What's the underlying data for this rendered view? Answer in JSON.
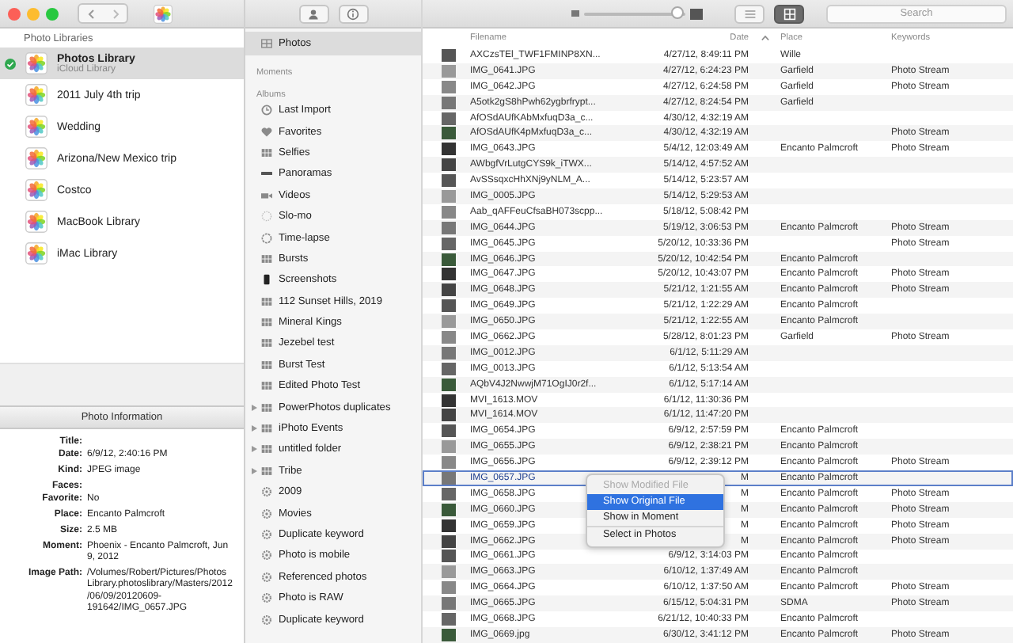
{
  "libraries": {
    "header": "Photo Libraries",
    "items": [
      {
        "name": "Photos Library",
        "subtitle": "iCloud Library",
        "selected": true,
        "current": true
      },
      {
        "name": "2011 July 4th trip",
        "selected": false,
        "current": false
      },
      {
        "name": "Wedding",
        "selected": false,
        "current": false
      },
      {
        "name": "Arizona/New Mexico trip",
        "selected": false,
        "current": false
      },
      {
        "name": "Costco",
        "selected": false,
        "current": false
      },
      {
        "name": "MacBook Library",
        "selected": false,
        "current": false
      },
      {
        "name": "iMac Library",
        "selected": false,
        "current": false
      }
    ]
  },
  "photo_information": {
    "title": "Photo Information",
    "fields": [
      {
        "label": "Title:"
      },
      {
        "label": "Date:",
        "value": "6/9/12, 2:40:16 PM"
      },
      {
        "label": "Kind:",
        "value": "JPEG image"
      },
      {
        "label": "Faces:"
      },
      {
        "label": "Favorite:",
        "value": "No"
      },
      {
        "label": "Place:",
        "value": "Encanto Palmcroft"
      },
      {
        "label": "Size:",
        "value": "2.5 MB"
      },
      {
        "label": "Moment:",
        "value": "Phoenix - Encanto Palmcroft, Jun 9, 2012"
      },
      {
        "label": "Image Path:",
        "value": "/Volumes/Robert/Pictures/Photos Library.photoslibrary/Masters/2012/06/09/20120609-191642/IMG_0657.JPG"
      }
    ]
  },
  "sidebar": {
    "items": [
      {
        "kind": "photos",
        "label": "Photos",
        "selected": true
      },
      {
        "kind": "header",
        "label": "Moments"
      },
      {
        "kind": "header",
        "label": "Albums"
      },
      {
        "kind": "import",
        "label": "Last Import",
        "selected": false
      },
      {
        "kind": "favorites",
        "label": "Favorites",
        "selected": false
      },
      {
        "kind": "album",
        "label": "Selfies",
        "selected": false
      },
      {
        "kind": "panoramas",
        "label": "Panoramas",
        "selected": false
      },
      {
        "kind": "videos",
        "label": "Videos",
        "selected": false
      },
      {
        "kind": "slomo",
        "label": "Slo-mo",
        "selected": false
      },
      {
        "kind": "timelapse",
        "label": "Time-lapse",
        "selected": false
      },
      {
        "kind": "album",
        "label": "Bursts",
        "selected": false
      },
      {
        "kind": "screenshots",
        "label": "Screenshots",
        "selected": false
      },
      {
        "kind": "album",
        "label": "112 Sunset Hills, 2019",
        "selected": false
      },
      {
        "kind": "album",
        "label": "Mineral Kings",
        "selected": false
      },
      {
        "kind": "album",
        "label": "Jezebel test",
        "selected": false
      },
      {
        "kind": "album",
        "label": "Burst Test",
        "selected": false
      },
      {
        "kind": "album",
        "label": "Edited Photo Test",
        "selected": false
      },
      {
        "kind": "folder",
        "label": "PowerPhotos duplicates",
        "selected": false
      },
      {
        "kind": "folder",
        "label": "iPhoto Events",
        "selected": false
      },
      {
        "kind": "folder",
        "label": "untitled folder",
        "selected": false
      },
      {
        "kind": "folder",
        "label": "Tribe",
        "selected": false
      },
      {
        "kind": "smart",
        "label": "2009",
        "selected": false
      },
      {
        "kind": "smart",
        "label": "Movies",
        "selected": false
      },
      {
        "kind": "smart",
        "label": "Duplicate keyword",
        "selected": false
      },
      {
        "kind": "smart",
        "label": "Photo is mobile",
        "selected": false
      },
      {
        "kind": "smart",
        "label": "Referenced photos",
        "selected": false
      },
      {
        "kind": "smart",
        "label": "Photo is RAW",
        "selected": false
      },
      {
        "kind": "smart",
        "label": "Duplicate keyword",
        "selected": false
      }
    ]
  },
  "toolbar": {
    "zoom_slider": {
      "level": 0.92
    },
    "view_buttons": [
      {
        "kind": "list",
        "selected": false
      },
      {
        "kind": "grid",
        "selected": true
      }
    ],
    "search": {
      "placeholder": "Search"
    }
  },
  "table": {
    "columns": [
      {
        "label": "Filename",
        "sorted": false
      },
      {
        "label": "Date",
        "sorted": true
      },
      {
        "label": "Place",
        "sorted": false
      },
      {
        "label": "Keywords",
        "sorted": false
      }
    ],
    "rows": [
      {
        "filename": "AXCzsTEl_TWF1FMINP8XN...",
        "date": "4/27/12, 8:49:11 PM",
        "place": "Wille",
        "selected": false
      },
      {
        "filename": "IMG_0641.JPG",
        "date": "4/27/12, 6:24:23 PM",
        "place": "Garfield",
        "keywords": "Photo Stream",
        "selected": false
      },
      {
        "filename": "IMG_0642.JPG",
        "date": "4/27/12, 6:24:58 PM",
        "place": "Garfield",
        "keywords": "Photo Stream",
        "selected": false
      },
      {
        "filename": "A5otk2gS8hPwh62ygbrfrypt...",
        "date": "4/27/12, 8:24:54 PM",
        "place": "Garfield",
        "selected": false
      },
      {
        "filename": "AfOSdAUfKAbMxfuqD3a_c...",
        "date": "4/30/12, 4:32:19 AM",
        "selected": false
      },
      {
        "filename": "AfOSdAUfK4pMxfuqD3a_c...",
        "date": "4/30/12, 4:32:19 AM",
        "keywords": "Photo Stream",
        "selected": false
      },
      {
        "filename": "IMG_0643.JPG",
        "date": "5/4/12, 12:03:49 AM",
        "place": "Encanto Palmcroft",
        "keywords": "Photo Stream",
        "selected": false
      },
      {
        "filename": "AWbgfVrLutgCYS9k_iTWX...",
        "date": "5/14/12, 4:57:52 AM",
        "selected": false
      },
      {
        "filename": "AvSSsqxcHhXNj9yNLM_A...",
        "date": "5/14/12, 5:23:57 AM",
        "selected": false
      },
      {
        "filename": "IMG_0005.JPG",
        "date": "5/14/12, 5:29:53 AM",
        "selected": false
      },
      {
        "filename": "Aab_qAFFeuCfsaBH073scpp...",
        "date": "5/18/12, 5:08:42 PM",
        "selected": false
      },
      {
        "filename": "IMG_0644.JPG",
        "date": "5/19/12, 3:06:53 PM",
        "place": "Encanto Palmcroft",
        "keywords": "Photo Stream",
        "selected": false
      },
      {
        "filename": "IMG_0645.JPG",
        "date": "5/20/12, 10:33:36 PM",
        "keywords": "Photo Stream",
        "selected": false
      },
      {
        "filename": "IMG_0646.JPG",
        "date": "5/20/12, 10:42:54 PM",
        "place": "Encanto Palmcroft",
        "selected": false
      },
      {
        "filename": "IMG_0647.JPG",
        "date": "5/20/12, 10:43:07 PM",
        "place": "Encanto Palmcroft",
        "keywords": "Photo Stream",
        "selected": false
      },
      {
        "filename": "IMG_0648.JPG",
        "date": "5/21/12, 1:21:55 AM",
        "place": "Encanto Palmcroft",
        "keywords": "Photo Stream",
        "selected": false
      },
      {
        "filename": "IMG_0649.JPG",
        "date": "5/21/12, 1:22:29 AM",
        "place": "Encanto Palmcroft",
        "selected": false
      },
      {
        "filename": "IMG_0650.JPG",
        "date": "5/21/12, 1:22:55 AM",
        "place": "Encanto Palmcroft",
        "selected": false
      },
      {
        "filename": "IMG_0662.JPG",
        "date": "5/28/12, 8:01:23 PM",
        "place": "Garfield",
        "keywords": "Photo Stream",
        "selected": false
      },
      {
        "filename": "IMG_0012.JPG",
        "date": "6/1/12, 5:11:29 AM",
        "selected": false
      },
      {
        "filename": "IMG_0013.JPG",
        "date": "6/1/12, 5:13:54 AM",
        "selected": false
      },
      {
        "filename": "AQbV4J2NwwjM71OgIJ0r2f...",
        "date": "6/1/12, 5:17:14 AM",
        "selected": false
      },
      {
        "filename": "MVI_1613.MOV",
        "date": "6/1/12, 11:30:36 PM",
        "selected": false
      },
      {
        "filename": "MVI_1614.MOV",
        "date": "6/1/12, 11:47:20 PM",
        "selected": false
      },
      {
        "filename": "IMG_0654.JPG",
        "date": "6/9/12, 2:57:59 PM",
        "place": "Encanto Palmcroft",
        "selected": false
      },
      {
        "filename": "IMG_0655.JPG",
        "date": "6/9/12, 2:38:21 PM",
        "place": "Encanto Palmcroft",
        "selected": false
      },
      {
        "filename": "IMG_0656.JPG",
        "date": "6/9/12, 2:39:12 PM",
        "place": "Encanto Palmcroft",
        "keywords": "Photo Stream",
        "selected": false
      },
      {
        "filename": "IMG_0657.JPG",
        "date": "M",
        "place": "Encanto Palmcroft",
        "selected": true
      },
      {
        "filename": "IMG_0658.JPG",
        "date": "M",
        "place": "Encanto Palmcroft",
        "keywords": "Photo Stream",
        "selected": false
      },
      {
        "filename": "IMG_0660.JPG",
        "date": "M",
        "place": "Encanto Palmcroft",
        "keywords": "Photo Stream",
        "selected": false
      },
      {
        "filename": "IMG_0659.JPG",
        "date": "M",
        "place": "Encanto Palmcroft",
        "keywords": "Photo Stream",
        "selected": false
      },
      {
        "filename": "IMG_0662.JPG",
        "date": "M",
        "place": "Encanto Palmcroft",
        "keywords": "Photo Stream",
        "selected": false
      },
      {
        "filename": "IMG_0661.JPG",
        "date": "6/9/12, 3:14:03 PM",
        "place": "Encanto Palmcroft",
        "selected": false
      },
      {
        "filename": "IMG_0663.JPG",
        "date": "6/10/12, 1:37:49 AM",
        "place": "Encanto Palmcroft",
        "selected": false
      },
      {
        "filename": "IMG_0664.JPG",
        "date": "6/10/12, 1:37:50 AM",
        "place": "Encanto Palmcroft",
        "keywords": "Photo Stream",
        "selected": false
      },
      {
        "filename": "IMG_0665.JPG",
        "date": "6/15/12, 5:04:31 PM",
        "place": "SDMA",
        "keywords": "Photo Stream",
        "selected": false
      },
      {
        "filename": "IMG_0668.JPG",
        "date": "6/21/12, 10:40:33 PM",
        "place": "Encanto Palmcroft",
        "selected": false
      },
      {
        "filename": "IMG_0669.jpg",
        "date": "6/30/12, 3:41:12 PM",
        "place": "Encanto Palmcroft",
        "keywords": "Photo Stream",
        "selected": false
      }
    ]
  },
  "context_menu": {
    "items": [
      {
        "kind": "item",
        "label": "Show Modified File",
        "disabled": true,
        "selected": false
      },
      {
        "kind": "item",
        "label": "Show Original File",
        "disabled": false,
        "selected": true
      },
      {
        "kind": "item",
        "label": "Show in Moment",
        "disabled": false,
        "selected": false
      },
      {
        "kind": "separator"
      },
      {
        "kind": "item",
        "label": "Select in Photos",
        "disabled": false,
        "selected": false
      }
    ]
  }
}
